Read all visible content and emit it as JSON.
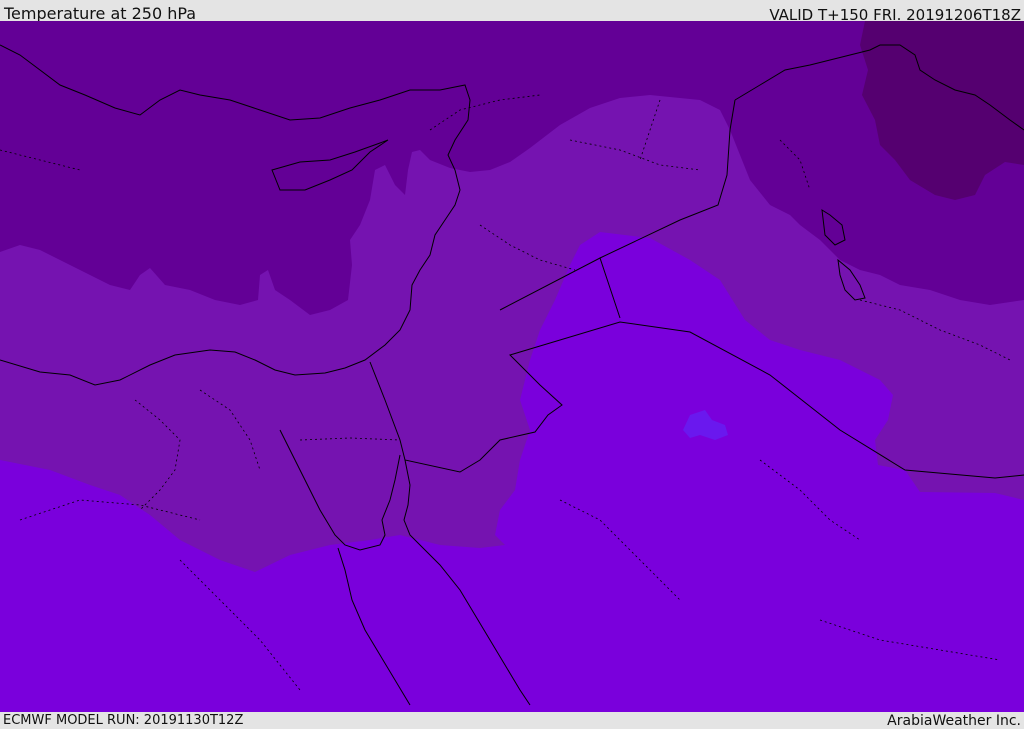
{
  "header": {
    "title": "Temperature at 250 hPa",
    "valid_time": "VALID T+150 FRI. 20191206T18Z"
  },
  "footer": {
    "model_run": "ECMWF MODEL RUN: 20191130T12Z",
    "credit": "ArabiaWeather Inc."
  },
  "map": {
    "field": "temperature",
    "level_hpa": 250,
    "colors": {
      "coldest": "#550070",
      "colder": "#630096",
      "cold": "#7513b0",
      "mild": "#7a00dc",
      "pocket": "#6a18ee",
      "border": "#000000"
    }
  }
}
